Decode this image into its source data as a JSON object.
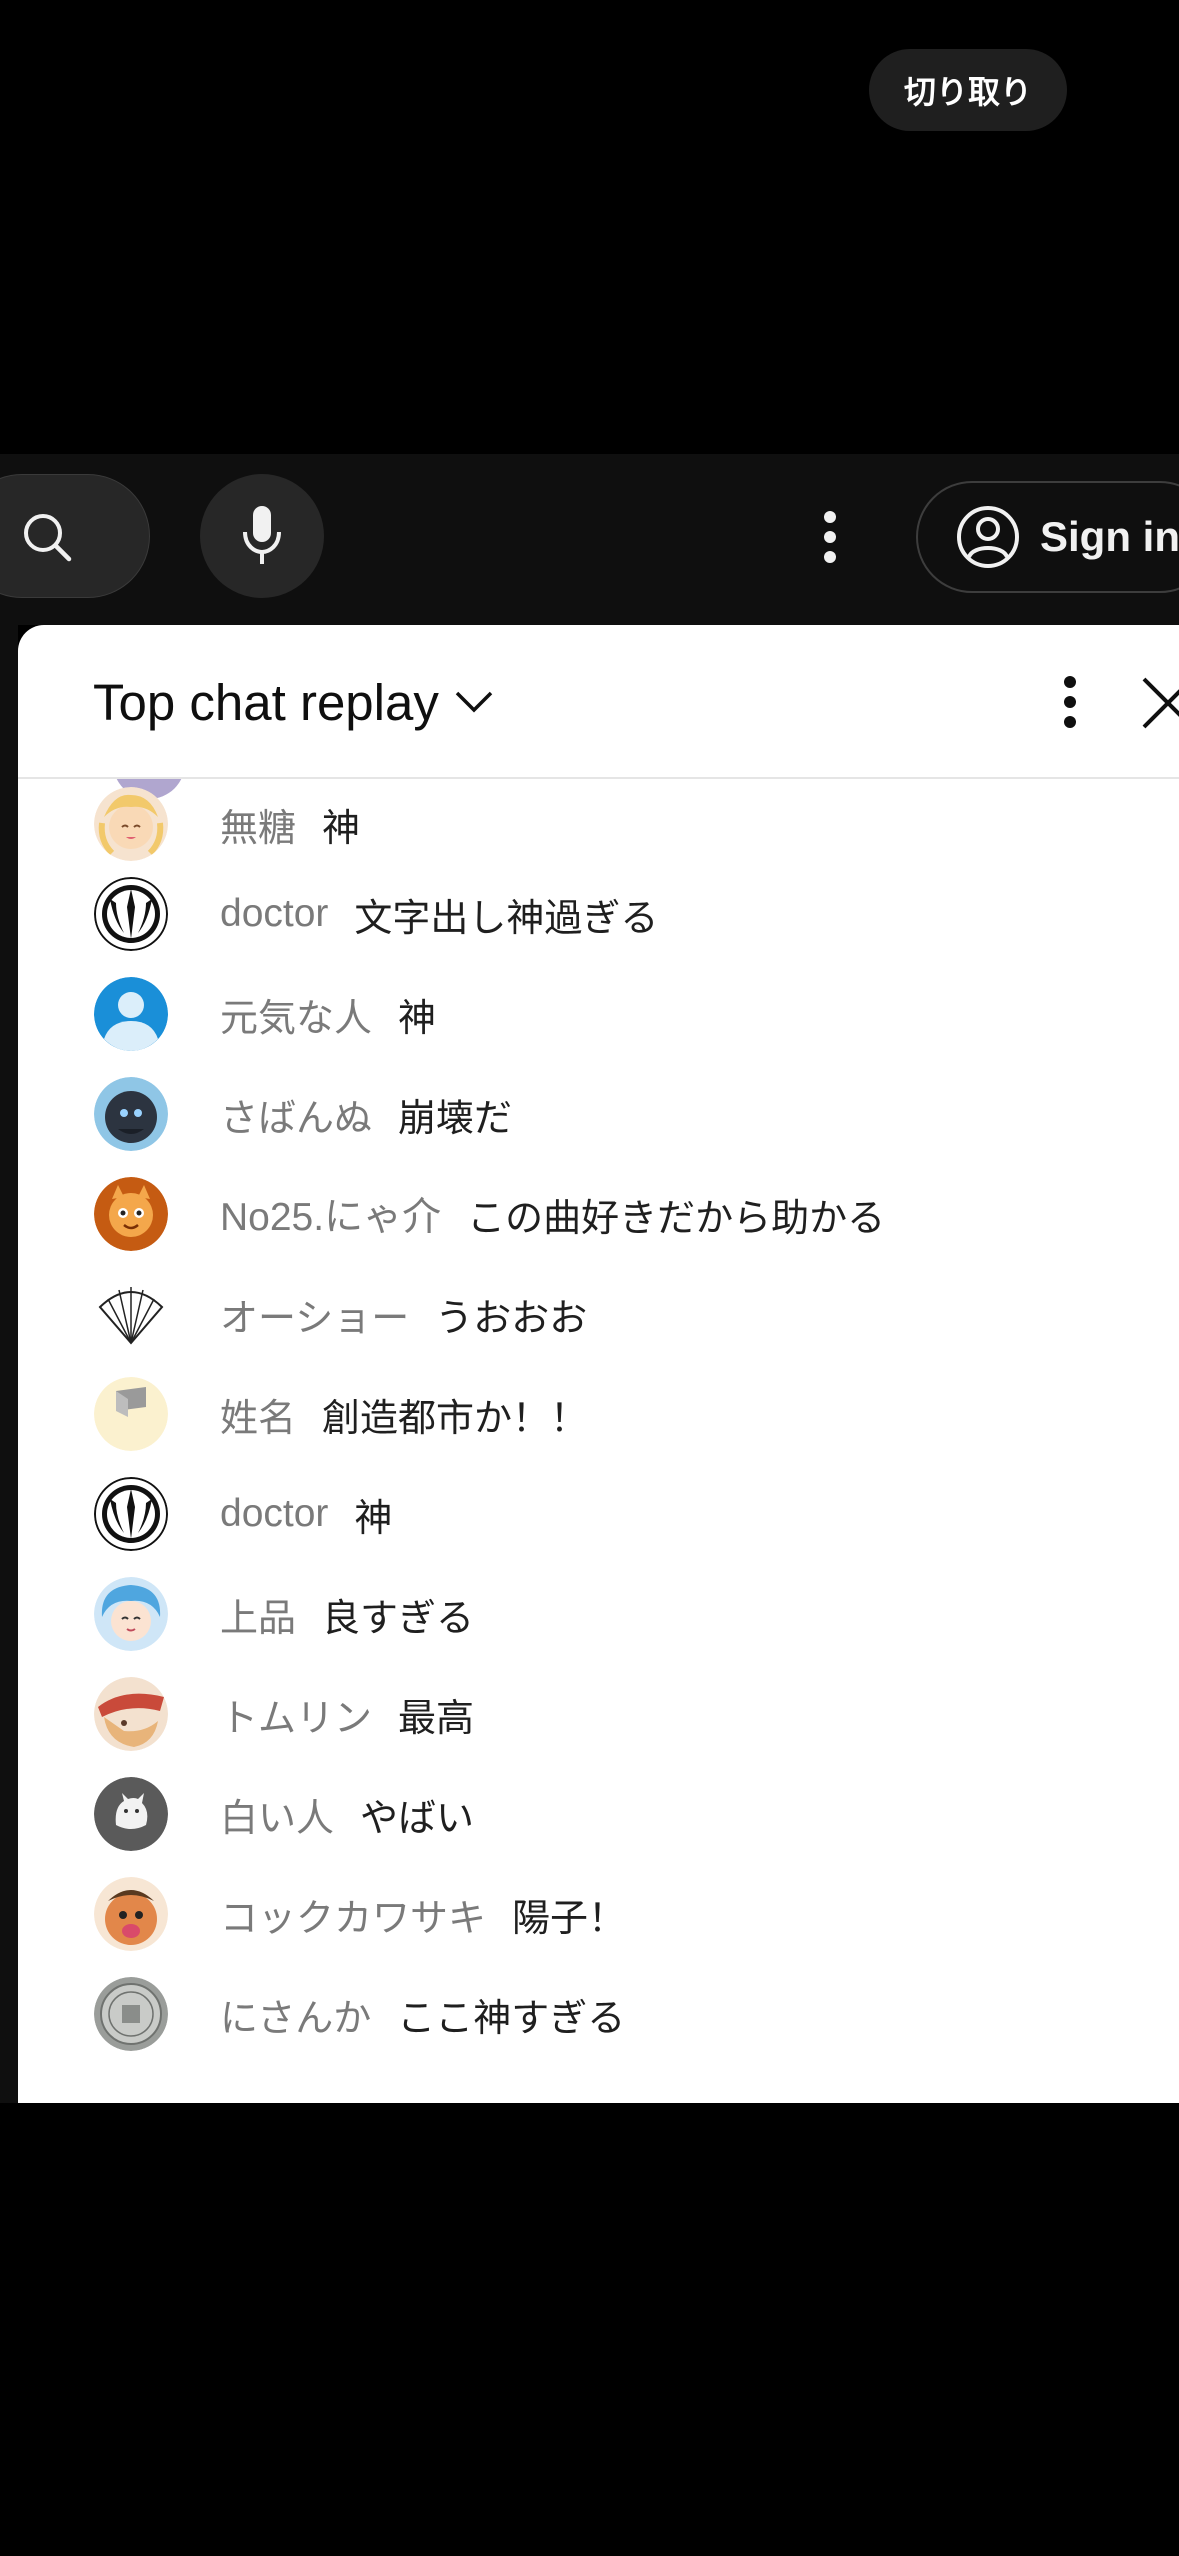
{
  "overlay": {
    "crop_label": "切り取り"
  },
  "header": {
    "signin_label": "Sign in",
    "icons": [
      "search-icon",
      "mic-icon",
      "more-vertical-icon",
      "account-circle-icon"
    ]
  },
  "chat": {
    "title": "Top chat replay",
    "icons": [
      "chevron-down-icon",
      "more-vertical-icon",
      "close-icon"
    ],
    "messages": [
      {
        "author": "無糖",
        "text": "神",
        "avatar_color": "#f6d7b8"
      },
      {
        "author": "doctor",
        "text": "文字出し神過ぎる",
        "avatar_color": "#ffffff"
      },
      {
        "author": "元気な人",
        "text": "神",
        "avatar_color": "#1a8fd8"
      },
      {
        "author": "さばんぬ",
        "text": "崩壊だ",
        "avatar_color": "#4f7fa6"
      },
      {
        "author": "No25.にゃ介",
        "text": "この曲好きだから助かる",
        "avatar_color": "#c55b12"
      },
      {
        "author": "オーショー",
        "text": "うおおお",
        "avatar_color": "#ffffff"
      },
      {
        "author": "姓名",
        "text": "創造都市か！！",
        "avatar_color": "#fbf1cf"
      },
      {
        "author": "doctor",
        "text": "神",
        "avatar_color": "#ffffff"
      },
      {
        "author": "上品",
        "text": "良すぎる",
        "avatar_color": "#7fb6e0"
      },
      {
        "author": "トムリン",
        "text": "最高",
        "avatar_color": "#e8c7a4"
      },
      {
        "author": "白い人",
        "text": "やばい",
        "avatar_color": "#5a5a5a"
      },
      {
        "author": "コックカワサキ",
        "text": "陽子！",
        "avatar_color": "#e2874a"
      },
      {
        "author": "にさんか",
        "text": "ここ神すぎる",
        "avatar_color": "#8a8d8a"
      }
    ]
  }
}
